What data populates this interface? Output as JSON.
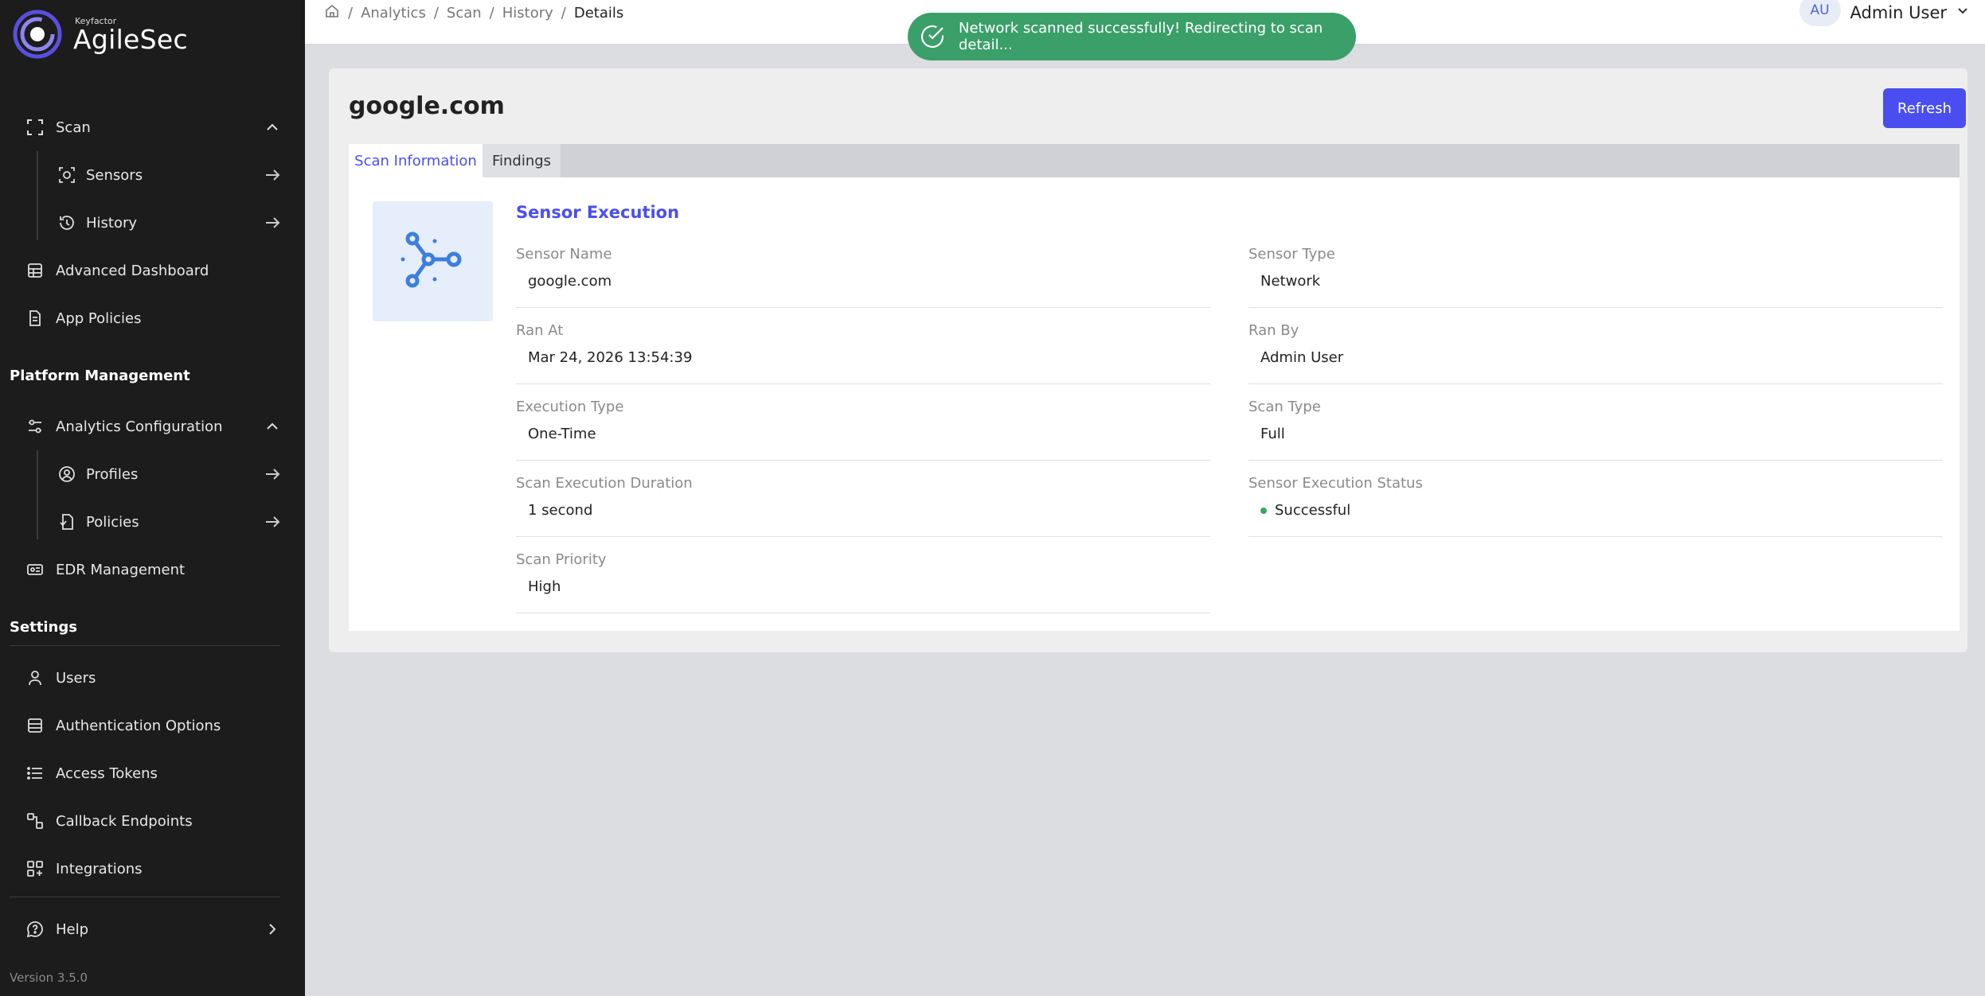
{
  "brand": {
    "small": "Keyfactor",
    "name": "AgileSec"
  },
  "sidebar": {
    "scan": {
      "label": "Scan"
    },
    "sensors": {
      "label": "Sensors"
    },
    "history": {
      "label": "History"
    },
    "advanced_dashboard": {
      "label": "Advanced Dashboard"
    },
    "app_policies": {
      "label": "App Policies"
    },
    "platform_title": "Platform Management",
    "analytics_config": {
      "label": "Analytics Configuration"
    },
    "profiles": {
      "label": "Profiles"
    },
    "policies": {
      "label": "Policies"
    },
    "edr": {
      "label": "EDR Management"
    },
    "settings_title": "Settings",
    "users": {
      "label": "Users"
    },
    "auth_options": {
      "label": "Authentication Options"
    },
    "access_tokens": {
      "label": "Access Tokens"
    },
    "callback_endpoints": {
      "label": "Callback Endpoints"
    },
    "integrations": {
      "label": "Integrations"
    },
    "help": {
      "label": "Help"
    },
    "version": "Version 3.5.0"
  },
  "breadcrumb": {
    "items": [
      "Analytics",
      "Scan",
      "History"
    ],
    "current": "Details",
    "separator": "/"
  },
  "user": {
    "initials": "AU",
    "name": "Admin User"
  },
  "toast": {
    "message": "Network scanned successfully! Redirecting to scan detail..."
  },
  "page": {
    "title": "google.com",
    "refresh_label": "Refresh",
    "tabs": [
      "Scan Information",
      "Findings"
    ],
    "section_title": "Sensor Execution"
  },
  "fields": {
    "sensor_name": {
      "label": "Sensor Name",
      "value": "google.com"
    },
    "sensor_type": {
      "label": "Sensor Type",
      "value": "Network"
    },
    "ran_at": {
      "label": "Ran At",
      "value": "Mar 24, 2026 13:54:39"
    },
    "ran_by": {
      "label": "Ran By",
      "value": "Admin User"
    },
    "execution_type": {
      "label": "Execution Type",
      "value": "One-Time"
    },
    "scan_type": {
      "label": "Scan Type",
      "value": "Full"
    },
    "duration": {
      "label": "Scan Execution Duration",
      "value": "1 second"
    },
    "status": {
      "label": "Sensor Execution Status",
      "value": "Successful"
    },
    "priority": {
      "label": "Scan Priority",
      "value": "High"
    }
  },
  "colors": {
    "accent": "#4a4ef0",
    "success": "#3b9f6a",
    "sidebar_bg": "#1c1c1c",
    "icon_blue": "#3d7fdf"
  }
}
